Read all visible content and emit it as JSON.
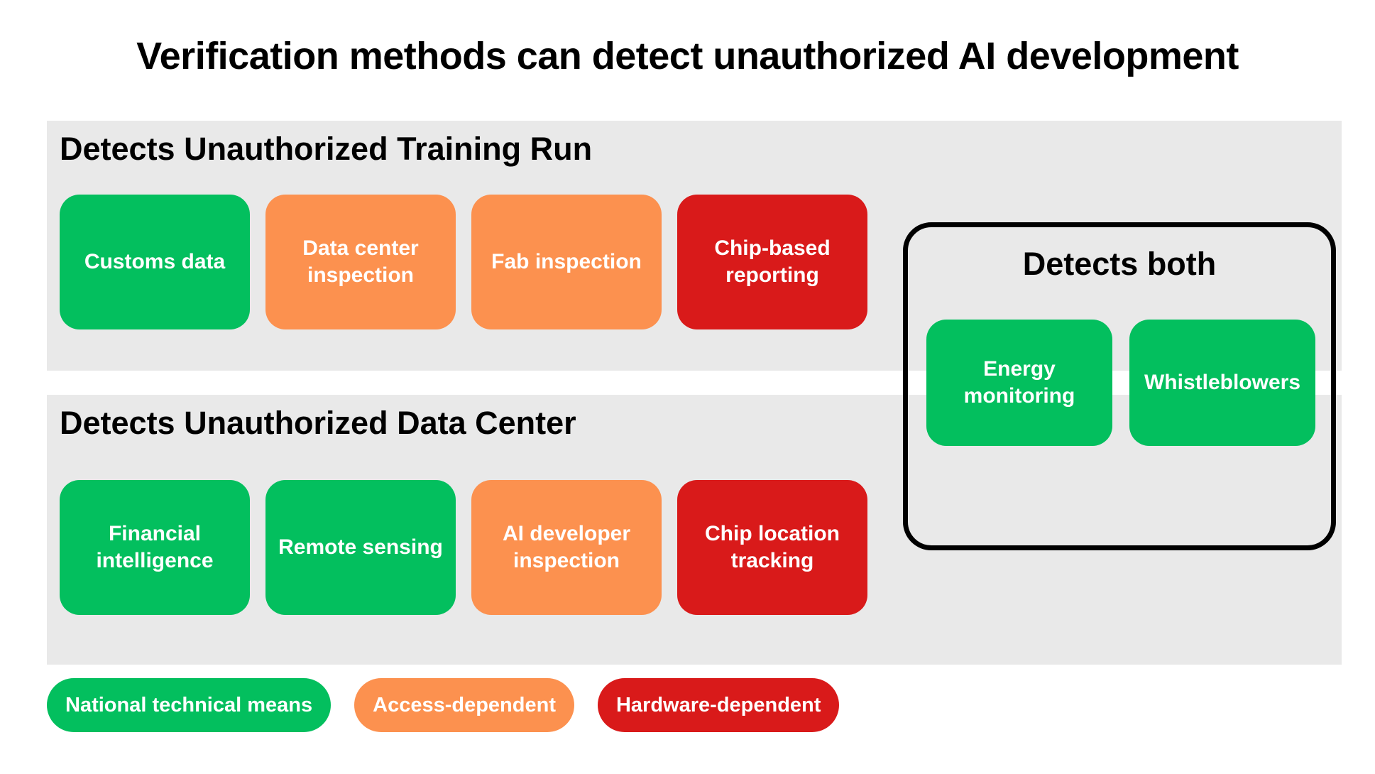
{
  "title": "Verification methods can detect unauthorized AI development",
  "colors": {
    "green": "#03BF5E",
    "orange": "#FC914F",
    "red": "#D91A1A",
    "panel_background": "#e9e9e9",
    "page_background": "#ffffff",
    "box_border": "#000000",
    "card_text": "#ffffff",
    "heading_text": "#000000"
  },
  "panels": [
    {
      "heading": "Detects Unauthorized Training Run",
      "cards": [
        {
          "label": "Customs data",
          "category": "green"
        },
        {
          "label": "Data center inspection",
          "category": "orange"
        },
        {
          "label": "Fab inspection",
          "category": "orange"
        },
        {
          "label": "Chip-based reporting",
          "category": "red"
        }
      ]
    },
    {
      "heading": "Detects Unauthorized Data Center",
      "cards": [
        {
          "label": "Financial intelligence",
          "category": "green"
        },
        {
          "label": "Remote sensing",
          "category": "green"
        },
        {
          "label": "AI developer inspection",
          "category": "orange"
        },
        {
          "label": "Chip location tracking",
          "category": "red"
        }
      ]
    }
  ],
  "detects_both": {
    "heading": "Detects both",
    "cards": [
      {
        "label": "Energy monitoring",
        "category": "green"
      },
      {
        "label": "Whistleblowers",
        "category": "green"
      }
    ]
  },
  "legend": [
    {
      "label": "National technical means",
      "category": "green"
    },
    {
      "label": "Access-dependent",
      "category": "orange"
    },
    {
      "label": "Hardware-dependent",
      "category": "red"
    }
  ]
}
